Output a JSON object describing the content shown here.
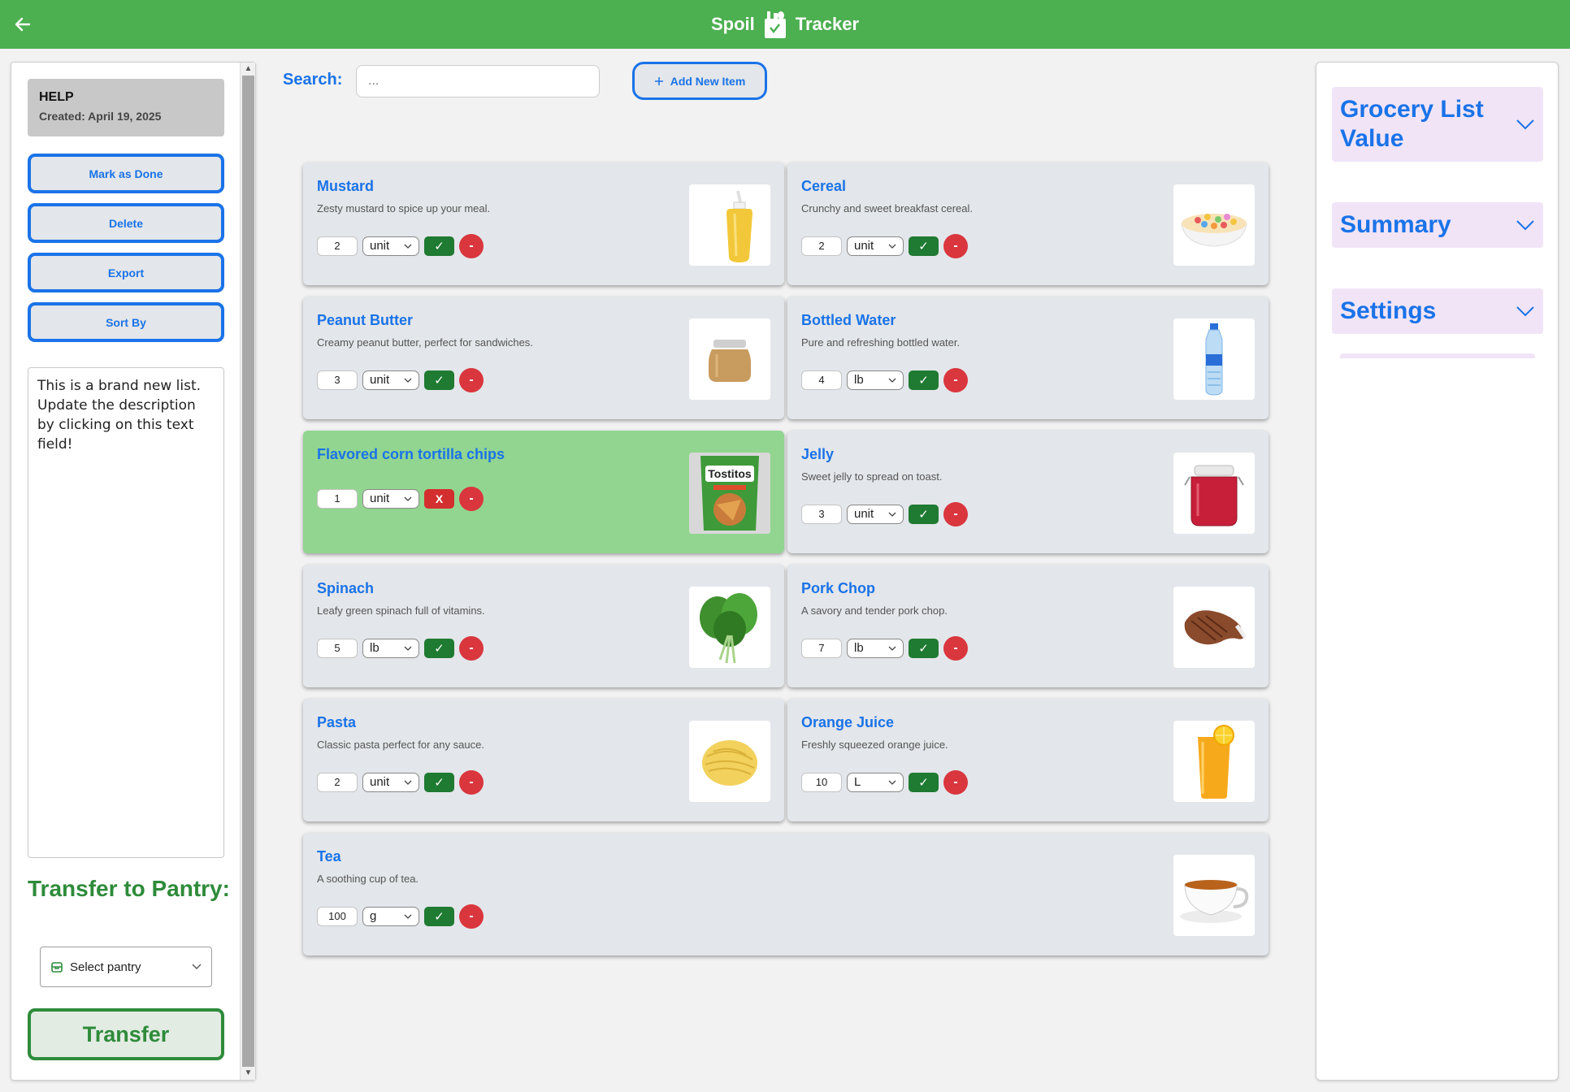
{
  "header": {
    "title_left": "Spoil",
    "title_right": "Tracker",
    "back_icon": "arrow-left-icon",
    "logo_icon": "grocery-bag-icon",
    "bar_color": "#4caf50"
  },
  "sidebar": {
    "help_title": "HELP",
    "created": "Created: April 19, 2025",
    "buttons": [
      "Mark as Done",
      "Delete",
      "Export",
      "Sort By"
    ],
    "description": "This is a brand new list. Update the description by clicking on this text field!",
    "transfer_title": "Transfer to Pantry:",
    "pantry_placeholder": "Select pantry",
    "transfer_button": "Transfer"
  },
  "search": {
    "label": "Search:",
    "placeholder": "...",
    "add_button": "Add New Item"
  },
  "items": [
    {
      "name": "Mustard",
      "desc": "Zesty mustard to spice up your meal.",
      "qty": "2",
      "unit": "unit",
      "done": false
    },
    {
      "name": "Cereal",
      "desc": "Crunchy and sweet breakfast cereal.",
      "qty": "2",
      "unit": "unit",
      "done": false
    },
    {
      "name": "Peanut Butter",
      "desc": "Creamy peanut butter, perfect for sandwiches.",
      "qty": "3",
      "unit": "unit",
      "done": false
    },
    {
      "name": "Bottled Water",
      "desc": "Pure and refreshing bottled water.",
      "qty": "4",
      "unit": "lb",
      "done": false
    },
    {
      "name": "Flavored corn tortilla chips",
      "desc": "",
      "qty": "1",
      "unit": "unit",
      "done": true
    },
    {
      "name": "Jelly",
      "desc": "Sweet jelly to spread on toast.",
      "qty": "3",
      "unit": "unit",
      "done": false
    },
    {
      "name": "Spinach",
      "desc": "Leafy green spinach full of vitamins.",
      "qty": "5",
      "unit": "lb",
      "done": false
    },
    {
      "name": "Pork Chop",
      "desc": "A savory and tender pork chop.",
      "qty": "7",
      "unit": "lb",
      "done": false
    },
    {
      "name": "Pasta",
      "desc": "Classic pasta perfect for any sauce.",
      "qty": "2",
      "unit": "unit",
      "done": false
    },
    {
      "name": "Orange Juice",
      "desc": "Freshly squeezed orange juice.",
      "qty": "10",
      "unit": "L",
      "done": false
    },
    {
      "name": "Tea",
      "desc": "A soothing cup of tea.",
      "qty": "100",
      "unit": "g",
      "done": false
    }
  ],
  "item_buttons": {
    "check": "✓",
    "uncheck": "X",
    "remove": "-"
  },
  "chips_logo_text": "Tostitos",
  "right_panel": {
    "sections": [
      "Grocery List Value",
      "Summary",
      "Settings"
    ]
  },
  "colors": {
    "accent": "#1a73e8",
    "green": "#2e8b3a",
    "done_card": "#92d590",
    "card": "#e3e6ea",
    "accordion": "#f1e4f7"
  }
}
